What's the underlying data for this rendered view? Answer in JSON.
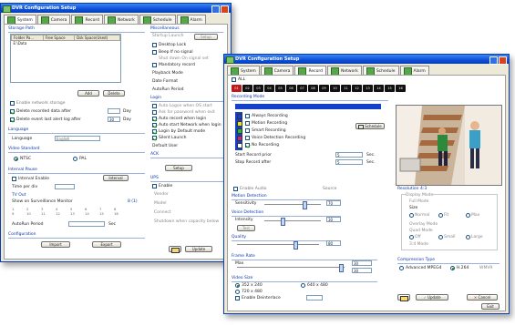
{
  "back_window": {
    "title": "DVR Configuration Setup",
    "tabs": [
      {
        "label": "System",
        "icon": "system-icon"
      },
      {
        "label": "Camera",
        "icon": "camera-icon"
      },
      {
        "label": "Record",
        "icon": "record-icon"
      },
      {
        "label": "Network",
        "icon": "network-icon"
      },
      {
        "label": "Schedule",
        "icon": "schedule-icon"
      },
      {
        "label": "Alarm",
        "icon": "alarm-icon"
      }
    ],
    "active_tab": "System",
    "storage_path": {
      "title": "Storage Path",
      "columns": [
        "Folder Pa...",
        "Free Space",
        "Dsk Space(Used)"
      ],
      "rows": [
        [
          "E:\\Data",
          "",
          ""
        ]
      ],
      "add_label": "Add",
      "delete_label": "Delete",
      "enable_network_storage": "Enable network storage",
      "delete_recorded_label": "Delete recorded data after",
      "delete_recorded_unit": "Day",
      "delete_event_label": "Delete event last alert log after",
      "delete_event_value": "30",
      "delete_event_unit": "Day"
    },
    "language": {
      "title": "Language",
      "label": "Language",
      "value": "English"
    },
    "video_standard": {
      "title": "Video Standard",
      "ntsc": "NTSC",
      "pal": "PAL"
    },
    "interval": {
      "title": "Interval Pause",
      "interval_enable": "Interval Enable",
      "interval_btn": "Interval",
      "time_per_div": "Time per div",
      "tv_out": "TV Out",
      "show_on": "Show on Surveillance Monitor",
      "show_value": "8 (1)",
      "numbers": [
        "1",
        "2",
        "3",
        "4",
        "5",
        "6",
        "7",
        "8",
        "9",
        "10",
        "11",
        "12",
        "13",
        "14",
        "15",
        "16"
      ],
      "autorun_period": "AutoRun Period",
      "autorun_unit": "Sec"
    },
    "configuration": {
      "title": "Configuration",
      "import_label": "Import",
      "export_label": "Export"
    },
    "misc": {
      "title": "Miscellaneous",
      "startup": "Startup Launch",
      "setup_btn": "Setup",
      "desktop_lock": "Desktop Lock",
      "beep": "Beep If no signal",
      "shut_down": "Shut down On signal set",
      "mandatory_record": "Mandatory record",
      "playback_mode": "Playback Mode",
      "date_format": "Date Format",
      "autorun_period": "AutoRun Period"
    },
    "login": {
      "title": "Login",
      "auto_logon": "Auto Logon when OS start",
      "ask_password": "Ask for password when exit",
      "auto_record": "Auto record when login",
      "auto_start_network": "Auto start Network when login",
      "login_default": "Login by Default mode",
      "silent_launch": "Silent Launch",
      "default_user": "Default User"
    },
    "ack": {
      "title": "ACK",
      "setup": "Setup"
    },
    "ups": {
      "title": "UPS",
      "enable": "Enable",
      "vendor": "Vendor",
      "model": "Model",
      "connect": "Connect",
      "shutdown": "Shutdown when capacity below"
    },
    "ok_label": "OK",
    "update_label": "Update"
  },
  "front_window": {
    "title": "DVR Configuration Setup",
    "tabs": [
      {
        "label": "System",
        "icon": "system-icon"
      },
      {
        "label": "Camera",
        "icon": "camera-icon"
      },
      {
        "label": "Record",
        "icon": "record-icon"
      },
      {
        "label": "Network",
        "icon": "network-icon"
      },
      {
        "label": "Schedule",
        "icon": "schedule-icon"
      },
      {
        "label": "Alarm",
        "icon": "alarm-icon"
      }
    ],
    "active_tab": "Record",
    "all_label": "ALL",
    "cameras": [
      "01",
      "02",
      "03",
      "04",
      "05",
      "06",
      "07",
      "08",
      "09",
      "10",
      "11",
      "12",
      "13",
      "14",
      "15",
      "16"
    ],
    "recording_mode": {
      "title": "Recording Mode",
      "modes": [
        {
          "label": "Always Recording",
          "color": "#1a3fd0"
        },
        {
          "label": "Motion Recording",
          "color": "#e7e21a"
        },
        {
          "label": "Smart Recording",
          "color": "#2cb82c"
        },
        {
          "label": "Voice Detection Recording",
          "color": "#c2268a"
        },
        {
          "label": "No Recording",
          "color": "#ffffff"
        }
      ],
      "schedule_btn": "Schedule",
      "start_record_prior": "Start Record prior",
      "start_value": "5",
      "stop_record_after": "Stop Record after",
      "stop_value": "5",
      "sec": "Sec."
    },
    "enable_audio": "Enable Audio",
    "audio_source": "Source",
    "motion_detection": {
      "title": "Motion Detection",
      "sensitivity": "Sensitivity",
      "value": "70"
    },
    "voice_detection": {
      "title": "Voice Detection",
      "intensity": "Intensity",
      "value": "30",
      "test": "Test"
    },
    "quality": {
      "title": "Quality",
      "value": "80"
    },
    "frame_rate": {
      "title": "Frame Rate",
      "max": "Max",
      "value": "30",
      "value2": "30"
    },
    "video_size": {
      "title": "Video Size",
      "opt1": "352 x 240",
      "opt2": "720 x 480",
      "opt3": "640 x 480",
      "deinterlace": "Enable Deinterlace"
    },
    "preview": {
      "title": "Resolution 4:3",
      "group": "Display Mode",
      "size": "Size",
      "full": "Full Mode",
      "quad": "Quad Mode",
      "three": "3:4 Mode",
      "overlay": "Overlay Mode",
      "row1": [
        "Normal",
        "Fit",
        "Max"
      ],
      "row2": [
        "Off",
        "Small",
        "Large"
      ]
    },
    "compression": {
      "title": "Compression Type",
      "opt1": "Advanced MPEG4",
      "opt2": "H.264",
      "opt3": "WMV9"
    },
    "update_label": "Update",
    "cancel_label": "Cancel",
    "exit_label": "Exit"
  }
}
